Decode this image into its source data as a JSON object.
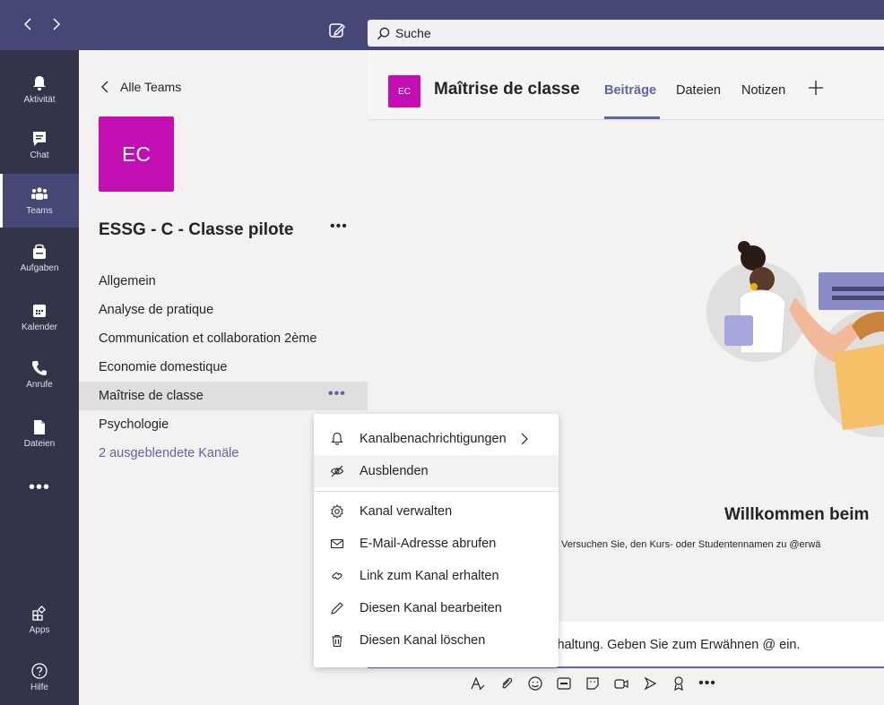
{
  "search": {
    "placeholder": "Suche"
  },
  "rail": {
    "items": [
      {
        "label": "Aktivität",
        "icon": "bell-icon"
      },
      {
        "label": "Chat",
        "icon": "chat-icon"
      },
      {
        "label": "Teams",
        "icon": "teams-icon"
      },
      {
        "label": "Aufgaben",
        "icon": "assignments-icon"
      },
      {
        "label": "Kalender",
        "icon": "calendar-icon"
      },
      {
        "label": "Anrufe",
        "icon": "phone-icon"
      },
      {
        "label": "Dateien",
        "icon": "files-icon"
      }
    ],
    "more": "•••",
    "apps": "Apps",
    "help": "Hilfe"
  },
  "panel": {
    "back_label": "Alle Teams",
    "team_initials": "EC",
    "team_name": "ESSG - C - Classe pilote",
    "team_more": "•••",
    "channels": [
      "Allgemein",
      "Analyse de pratique",
      "Communication et collaboration 2ème",
      "Economie domestique",
      "Maîtrise de classe",
      "Psychologie"
    ],
    "hidden_channels": "2 ausgeblendete Kanäle",
    "channel_more": "•••"
  },
  "channel": {
    "initials": "EC",
    "title": "Maîtrise de classe",
    "tabs": [
      "Beiträge",
      "Dateien",
      "Notizen"
    ],
    "active_tab": "Beiträge"
  },
  "welcome": {
    "title": "Willkommen beim",
    "subtitle": "Versuchen Sie, den Kurs- oder Studentennamen zu @erwä"
  },
  "composer": {
    "text": "Beginnen Sie eine neue Unterhaltung. Geben Sie zum Erwähnen @ ein."
  },
  "menu": {
    "items": [
      {
        "label": "Kanalbenachrichtigungen",
        "icon": "bell-icon"
      },
      {
        "label": "Ausblenden",
        "icon": "eye-off-icon"
      },
      {
        "label": "Kanal verwalten",
        "icon": "gear-icon"
      },
      {
        "label": "E-Mail-Adresse abrufen",
        "icon": "mail-icon"
      },
      {
        "label": "Link zum Kanal erhalten",
        "icon": "link-icon"
      },
      {
        "label": "Diesen Kanal bearbeiten",
        "icon": "pencil-icon"
      },
      {
        "label": "Diesen Kanal löschen",
        "icon": "trash-icon"
      }
    ]
  },
  "colors": {
    "brand": "#464775",
    "rail": "#33344a",
    "accent": "#6264a7",
    "team_avatar": "#c20fb4"
  }
}
